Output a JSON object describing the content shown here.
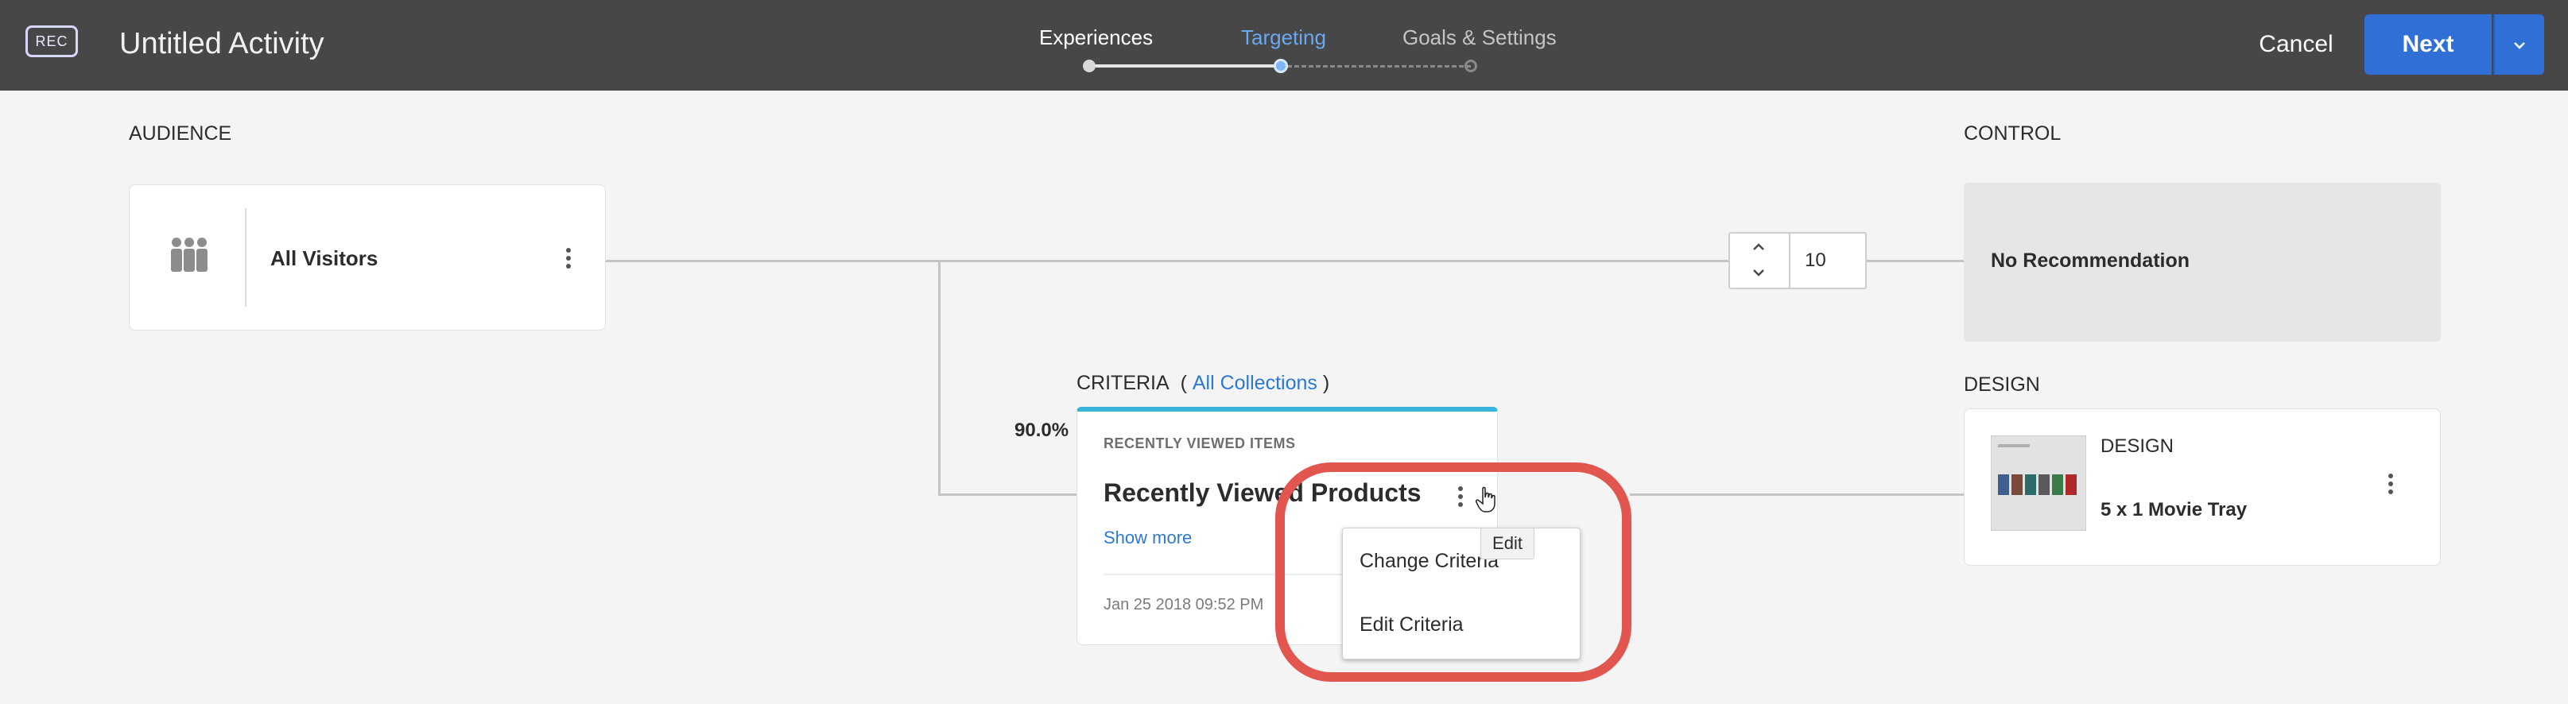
{
  "header": {
    "badge": "REC",
    "title": "Untitled Activity",
    "steps": [
      {
        "label": "Experiences",
        "state": "complete"
      },
      {
        "label": "Targeting",
        "state": "current"
      },
      {
        "label": "Goals & Settings",
        "state": "upcoming"
      }
    ],
    "cancel_label": "Cancel",
    "next_label": "Next",
    "next_menu_icon": "chevron-down-icon"
  },
  "audience": {
    "section_label": "AUDIENCE",
    "name": "All Visitors",
    "icon": "people-icon",
    "menu_icon": "kebab-icon"
  },
  "control": {
    "section_label": "CONTROL",
    "traffic_value": "10",
    "text": "No Recommendation"
  },
  "criteria": {
    "section_label": "CRITERIA",
    "open_paren": "(",
    "collection_link": "All Collections",
    "close_paren": ")",
    "percent": "90.0%",
    "type": "RECENTLY VIEWED ITEMS",
    "name": "Recently Viewed Products",
    "show_more": "Show more",
    "date": "Jan 25 2018 09:52 PM",
    "menu_icon": "kebab-icon"
  },
  "design": {
    "section_label": "DESIGN",
    "header": "DESIGN",
    "name": "5 x 1 Movie Tray",
    "menu_icon": "kebab-icon"
  },
  "context_menu": {
    "tooltip": "Edit",
    "items": [
      "Change Criteria",
      "Edit Criteria"
    ]
  },
  "colors": {
    "header_bg": "#474747",
    "accent_blue": "#2f6fd6",
    "link_blue": "#2d79d0",
    "criteria_accent": "#39b4dc",
    "highlight_red": "#e2564f"
  }
}
